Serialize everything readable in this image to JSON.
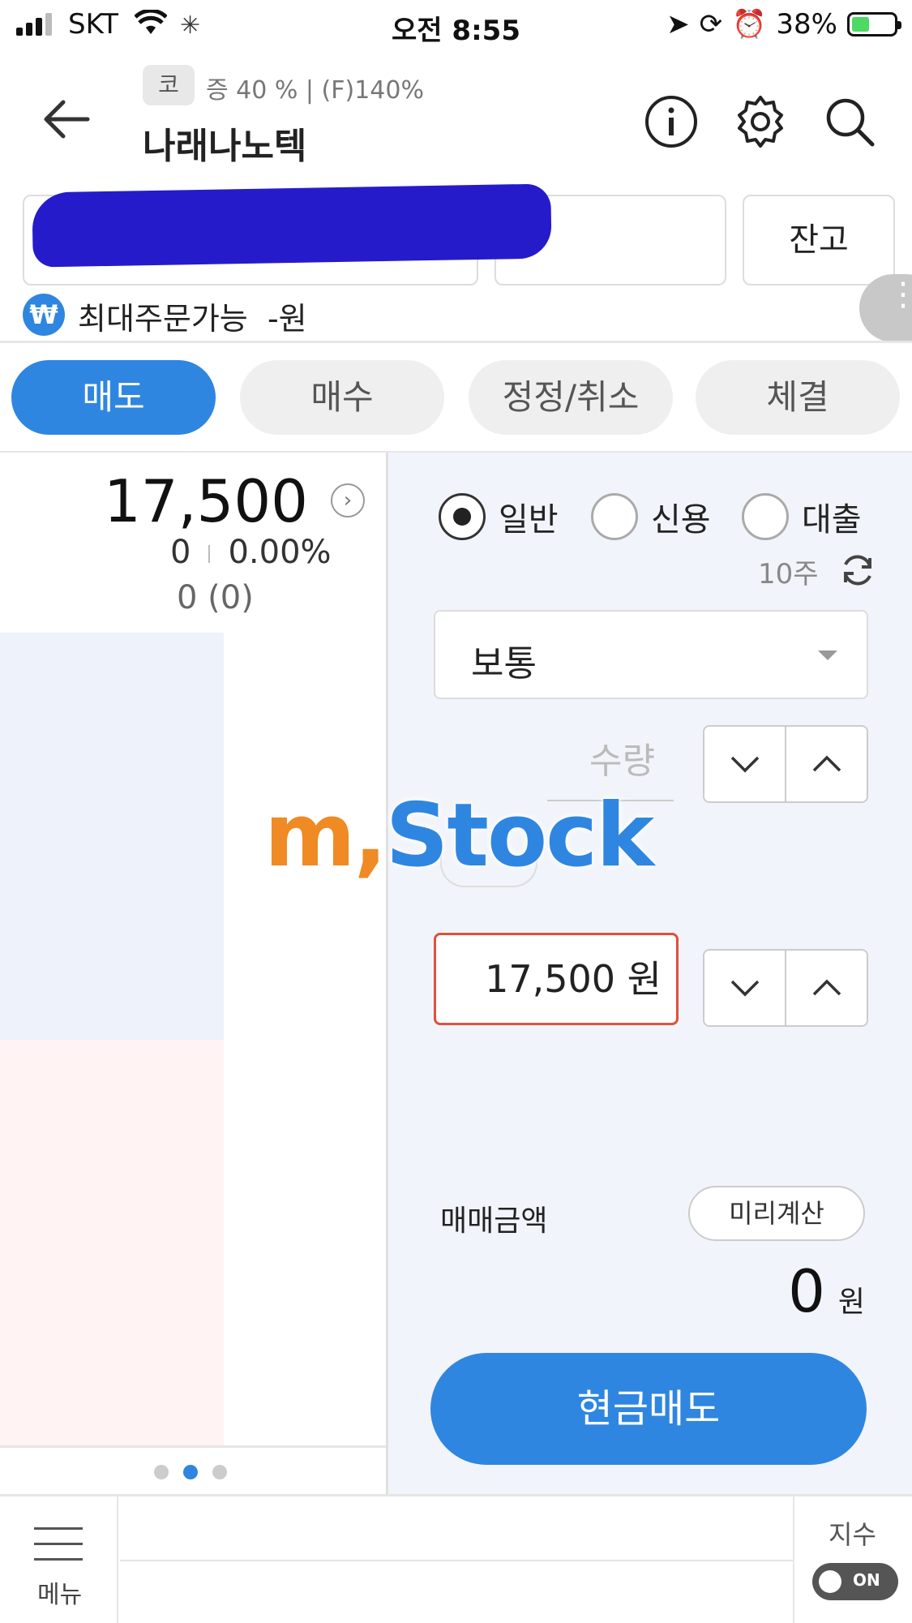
{
  "status_bar": {
    "carrier": "SKT",
    "time": "오전 8:55",
    "battery": "38%"
  },
  "header": {
    "market_badge": "코",
    "margin_info": "증 40 % | (F)140%",
    "stock_name": "나래나노텍"
  },
  "account": {
    "balance_button": "잔고",
    "max_order_label": "최대주문가능",
    "max_order_value": "-원"
  },
  "tabs": [
    {
      "label": "매도",
      "active": true
    },
    {
      "label": "매수",
      "active": false
    },
    {
      "label": "정정/취소",
      "active": false
    },
    {
      "label": "체결",
      "active": false
    }
  ],
  "quote": {
    "price": "17,500",
    "change": "0",
    "change_rate": "0.00%",
    "volume": "0 (0)"
  },
  "order": {
    "credit_types": [
      "일반",
      "신용",
      "대출"
    ],
    "selected_credit_type": "일반",
    "holding": "10주",
    "order_type": "보통",
    "quantity_label": "수량",
    "price_value": "17,500 원",
    "amount_label": "매매금액",
    "precalc_button": "미리계산",
    "amount_value": "0",
    "amount_unit": "원",
    "submit_button": "현금매도"
  },
  "watermark": {
    "prefix": "m,",
    "rest": "Stock"
  },
  "bottom_bar": {
    "menu_label": "메뉴",
    "index_label": "지수",
    "index_toggle": "ON"
  },
  "colors": {
    "accent": "#2f86e0",
    "price_border": "#e0503e",
    "watermark_orange": "#f08a24"
  }
}
